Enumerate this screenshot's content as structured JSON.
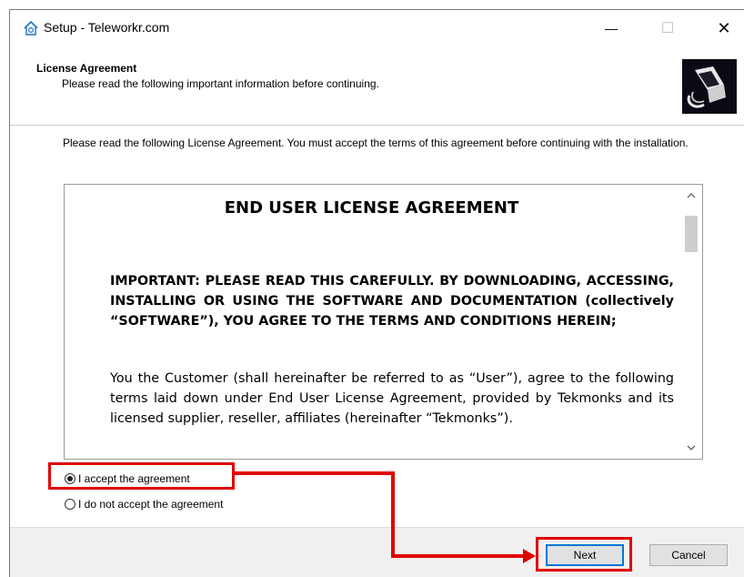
{
  "window": {
    "title": "Setup - Teleworkr.com",
    "controls": {
      "minimize": "—",
      "maximize": "☐",
      "close": "✕"
    }
  },
  "header": {
    "title": "License Agreement",
    "subtitle": "Please read the following important information before continuing."
  },
  "instructions": "Please read the following License Agreement. You must accept the terms of this agreement before continuing with the installation.",
  "eula": {
    "title": "END USER LICENSE AGREEMENT",
    "important": "IMPORTANT: PLEASE READ THIS CAREFULLY. BY DOWNLOADING, ACCESSING, INSTALLING OR USING THE SOFTWARE AND DOCUMENTATION (collectively “SOFTWARE”), YOU AGREE TO THE TERMS AND CONDITIONS HEREIN;",
    "body": "You the Customer (shall hereinafter be referred to as “User”), agree to the following terms laid down under End User License Agreement, provided by Tekmonks and its licensed supplier, reseller, affiliates (hereinafter “Tekmonks”)."
  },
  "options": {
    "accept": {
      "label": "I accept the agreement",
      "selected": true
    },
    "decline": {
      "label": "I do not accept the agreement",
      "selected": false
    }
  },
  "buttons": {
    "next": "Next",
    "cancel": "Cancel"
  },
  "annotation": {
    "highlight_color": "#e00000"
  }
}
